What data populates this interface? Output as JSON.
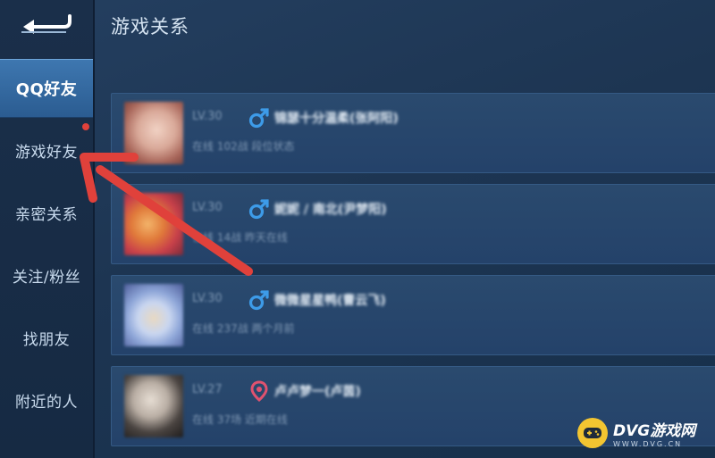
{
  "header": {
    "title": "游戏关系"
  },
  "sidebar": {
    "items": [
      {
        "label": "QQ好友",
        "active": true
      },
      {
        "label": "游戏好友",
        "active": false,
        "badge_dot": true
      },
      {
        "label": "亲密关系",
        "active": false
      },
      {
        "label": "关注/粉丝",
        "active": false
      },
      {
        "label": "找朋友",
        "active": false
      },
      {
        "label": "附近的人",
        "active": false
      }
    ],
    "back_icon": "back-arrow-icon"
  },
  "friends": [
    {
      "level": "LV.30",
      "gender": "male",
      "name": "锦瑟十分温柔(张阿阳)",
      "status": "在线 102战 段位状态"
    },
    {
      "level": "LV.30",
      "gender": "male",
      "name": "妮妮 / 南北(尹梦阳)",
      "status": "在线 14战 昨天在线"
    },
    {
      "level": "LV.30",
      "gender": "male",
      "name": "微微星星鸭(曹云飞)",
      "status": "在线 237战 两个月前"
    },
    {
      "level": "LV.27",
      "gender": "female",
      "name": "卢卢梦一(卢茵)",
      "status": "在线 37场 近期在线"
    }
  ],
  "colors": {
    "male": "#3d9be8",
    "female": "#e0526f",
    "active_tab": "#3e77b0",
    "arrow": "#e0413b",
    "badge": "#e0413b"
  },
  "watermark": {
    "title": "DVG游戏网",
    "url": "WWW.DVG.CN"
  }
}
